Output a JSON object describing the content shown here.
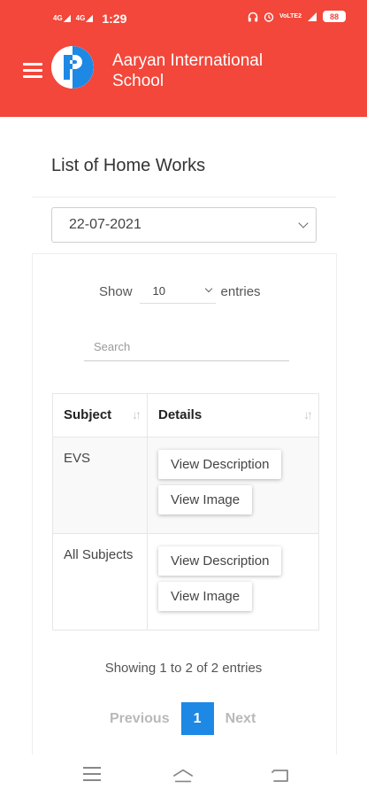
{
  "status_bar": {
    "signal1": "4G",
    "signal2": "4G",
    "time": "1:29",
    "network": "VoLTE2",
    "battery": "88",
    "icons": [
      "headphones-icon",
      "alarm-icon",
      "wifi-signal-icon",
      "battery-icon"
    ]
  },
  "header": {
    "menu_icon": "hamburger-icon",
    "logo_letter": "P",
    "title": "Aaryan International School",
    "background_color": "#f2473a"
  },
  "page": {
    "title": "List of Home Works",
    "date_value": "22-07-2021"
  },
  "table_controls": {
    "show_label": "Show",
    "entries_value": "10",
    "entries_label": "entries",
    "search_placeholder": "Search"
  },
  "table": {
    "columns": [
      "Subject",
      "Details"
    ],
    "rows": [
      {
        "subject": "EVS",
        "actions": [
          "View Description",
          "View Image"
        ]
      },
      {
        "subject": "All Subjects",
        "actions": [
          "View Description",
          "View Image"
        ]
      }
    ]
  },
  "footer": {
    "showing_text": "Showing 1 to 2 of 2 entries",
    "previous": "Previous",
    "current_page": "1",
    "next": "Next",
    "accent_color": "#1e88e5"
  },
  "nav_bar": {
    "icons": [
      "menu-icon",
      "home-icon",
      "back-icon"
    ]
  }
}
